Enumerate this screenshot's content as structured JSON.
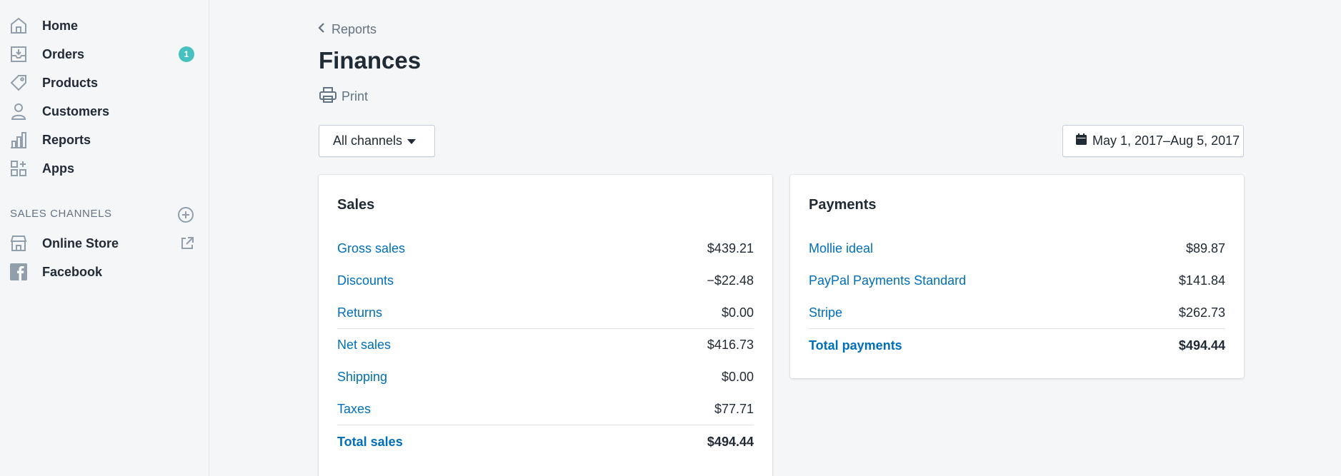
{
  "sidebar": {
    "items": [
      {
        "label": "Home",
        "icon": "home-icon"
      },
      {
        "label": "Orders",
        "icon": "orders-icon",
        "badge": "1"
      },
      {
        "label": "Products",
        "icon": "tag-icon"
      },
      {
        "label": "Customers",
        "icon": "person-icon"
      },
      {
        "label": "Reports",
        "icon": "bar-chart-icon"
      },
      {
        "label": "Apps",
        "icon": "apps-icon"
      }
    ],
    "sales_channels_heading": "SALES CHANNELS",
    "channels": [
      {
        "label": "Online Store",
        "icon": "store-icon"
      },
      {
        "label": "Facebook",
        "icon": "facebook-icon"
      }
    ]
  },
  "header": {
    "breadcrumb": "Reports",
    "title": "Finances",
    "print_label": "Print"
  },
  "filters": {
    "channel_label": "All channels",
    "date_range": "May 1, 2017–Aug 5, 2017"
  },
  "sales": {
    "title": "Sales",
    "rows": [
      {
        "label": "Gross sales",
        "value": "$439.21"
      },
      {
        "label": "Discounts",
        "value": "−$22.48"
      },
      {
        "label": "Returns",
        "value": "$0.00"
      },
      {
        "label": "Net sales",
        "value": "$416.73"
      },
      {
        "label": "Shipping",
        "value": "$0.00"
      },
      {
        "label": "Taxes",
        "value": "$77.71"
      },
      {
        "label": "Total sales",
        "value": "$494.44"
      }
    ]
  },
  "payments": {
    "title": "Payments",
    "rows": [
      {
        "label": "Mollie ideal",
        "value": "$89.87"
      },
      {
        "label": "PayPal Payments Standard",
        "value": "$141.84"
      },
      {
        "label": "Stripe",
        "value": "$262.73"
      },
      {
        "label": "Total payments",
        "value": "$494.44"
      }
    ]
  },
  "colors": {
    "link": "#006fbb",
    "badge": "#47c1bf",
    "background": "#f4f6f8",
    "icon": "#919eab"
  }
}
